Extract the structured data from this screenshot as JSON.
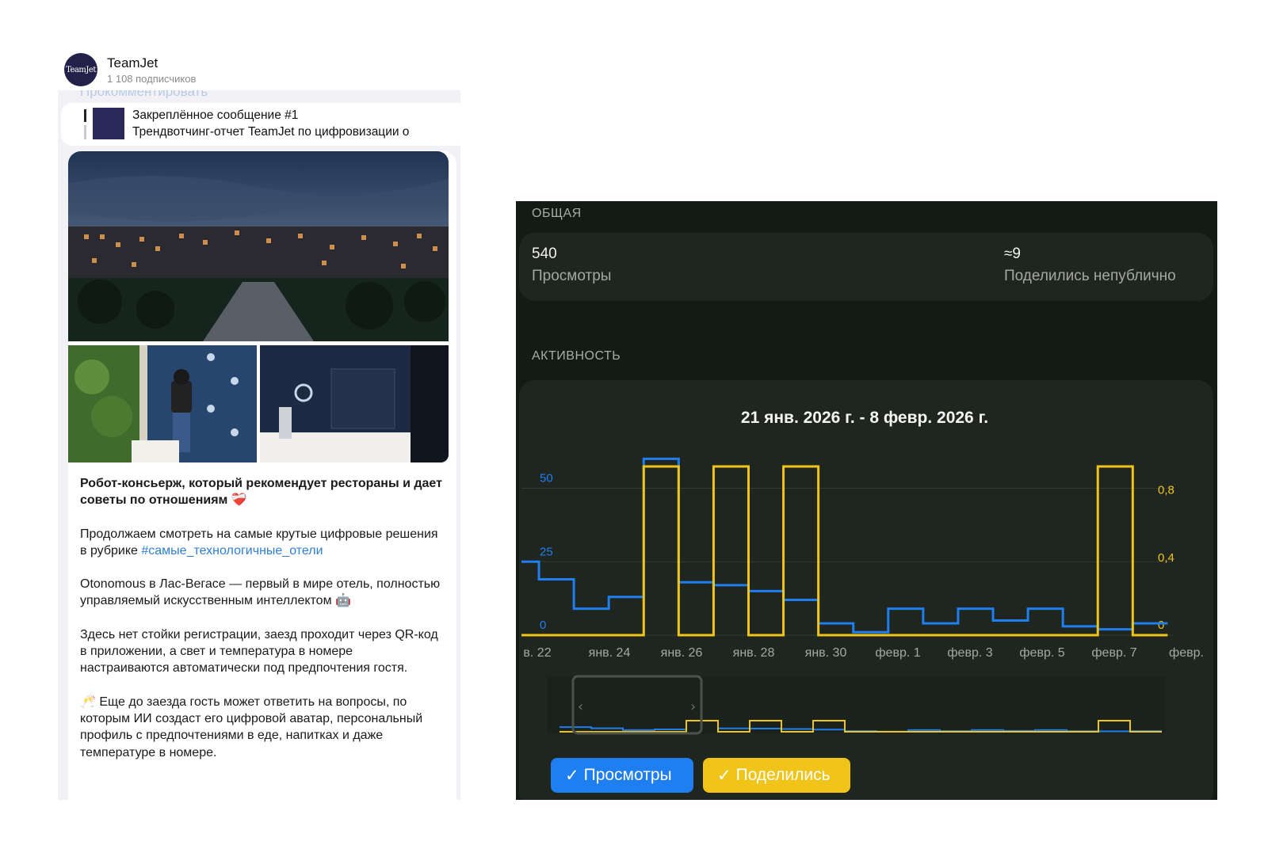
{
  "telegram": {
    "channel_name": "TeamJet",
    "avatar_text": "TeamJet",
    "subscribers": "1 108 подписчиков",
    "ghost_comment": "Прокомментировать",
    "pinned": {
      "title": "Закреплённое сообщение #1",
      "text": "Трендвотчинг-отчет TeamJet по цифровизации о"
    },
    "post": {
      "title": "Робот-консьерж, который рекомендует рестораны и дает советы по отношениям ❤️‍🩹",
      "p1": "Продолжаем смотреть на самые крутые цифровые решения в рубрике ",
      "hashtag": "#самые_технологичные_отели",
      "p2": "Otonomous в Лас-Вегасе — первый в мире отель, полностью управляемый искусственным интеллектом 🤖",
      "p3": "Здесь нет стойки регистрации, заезд проходит через QR-код в приложении, а свет и температура в номере настраиваются автоматически под предпочтения гостя.",
      "p4": "🥂 Еще до заезда гость может ответить на вопросы, по которым ИИ создаст его цифровой аватар, персональный профиль с предпочтениями в еде, напитках и даже температуре в номере."
    }
  },
  "stats": {
    "overview_label": "ОБЩАЯ",
    "views_value": "540",
    "views_caption": "Просмотры",
    "shares_value": "≈9",
    "shares_caption": "Поделились непублично",
    "activity_label": "АКТИВНОСТЬ",
    "date_range": "21 янв. 2026 г. - 8 февр. 2026 г.",
    "btn_views": "Просмотры",
    "btn_shares": "Поделились",
    "colors": {
      "views": "#1f7ef0",
      "shares": "#f0c419"
    }
  },
  "chart_data": {
    "type": "line",
    "step": true,
    "x_tick_labels": [
      "в. 22",
      "янв. 24",
      "янв. 26",
      "янв. 28",
      "янв. 30",
      "февр. 1",
      "февр. 3",
      "февр. 5",
      "февр. 7",
      "февр."
    ],
    "left_axis": {
      "ticks": [
        "0",
        "25",
        "50"
      ],
      "ylim": [
        0,
        62
      ]
    },
    "right_axis": {
      "ticks": [
        "0",
        "0,4",
        "0,8"
      ],
      "ylim": [
        0,
        1
      ]
    },
    "grid": true,
    "series": [
      {
        "name": "Просмотры",
        "axis": "left",
        "color": "#1f7ef0",
        "values": [
          25,
          19,
          9,
          13,
          60,
          18,
          17,
          15,
          12,
          4,
          1,
          9,
          4,
          9,
          5,
          9,
          3,
          2,
          4
        ]
      },
      {
        "name": "Поделились",
        "axis": "right",
        "color": "#f0c419",
        "values": [
          0,
          0,
          0,
          0,
          1,
          0,
          1,
          0,
          1,
          0,
          0,
          0,
          0,
          0,
          0,
          0,
          0,
          1,
          0
        ]
      }
    ]
  }
}
